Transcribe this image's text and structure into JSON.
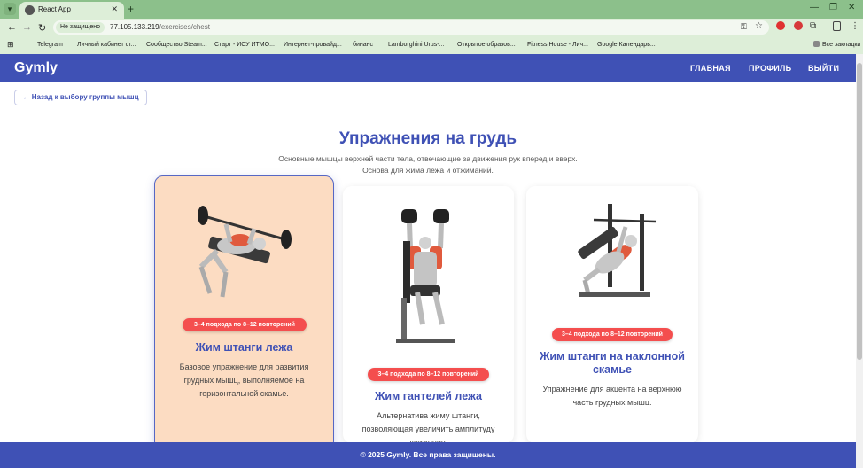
{
  "browser": {
    "tab_title": "React App",
    "new_tab": "+",
    "not_secure": "Не защищено",
    "url_host": "77.105.133.219",
    "url_path": "/exercises/chest",
    "bookmarks": [
      {
        "label": "Telegram",
        "color": "#2aa3df"
      },
      {
        "label": "Личный кабинет ст...",
        "color": "#3b5bdb"
      },
      {
        "label": "Сообщество Steam...",
        "color": "#1b2838"
      },
      {
        "label": "Старт - ИСУ ИТМО...",
        "color": "#444444"
      },
      {
        "label": "Интернет-провайд...",
        "color": "#e03131"
      },
      {
        "label": "бинанс",
        "color": "#f0b90b"
      },
      {
        "label": "Lamborghini Urus-...",
        "color": "#111111"
      },
      {
        "label": "Открытое образов...",
        "color": "#4c6ef5"
      },
      {
        "label": "Fitness House - Лич...",
        "color": "#3b3b98"
      },
      {
        "label": "Google Календарь...",
        "color": "#4285f4"
      }
    ],
    "all_bookmarks": "Все закладки"
  },
  "app": {
    "logo": "Gymly",
    "nav": [
      "ГЛАВНАЯ",
      "ПРОФИЛЬ",
      "ВЫЙТИ"
    ],
    "back_button": "← Назад к выбору группы мышц",
    "title": "Упражнения на грудь",
    "subtitle_line1": "Основные мышцы верхней части тела, отвечающие за движения рук вперед и вверх.",
    "subtitle_line2": "Основа для жима лежа и отжиманий.",
    "accent_color": "#3f51b5",
    "badge_color": "#f44e4e"
  },
  "exercises": [
    {
      "badge": "3–4 подхода по 8–12 повторений",
      "title": "Жим штанги лежа",
      "description": "Базовое упражнение для развития грудных мышц, выполняемое на горизонтальной скамье.",
      "icon": "barbell-bench-press-illustration"
    },
    {
      "badge": "3–4 подхода по 8–12 повторений",
      "title": "Жим гантелей лежа",
      "description": "Альтернатива жиму штанги, позволяющая увеличить амплитуду движения.",
      "icon": "dumbbell-press-illustration"
    },
    {
      "badge": "3–4 подхода по 8–12 повторений",
      "title_line1": "Жим штанги на наклонной",
      "title_line2": "скамье",
      "description": "Упражнение для акцента на верхнюю часть грудных мышц.",
      "icon": "incline-bench-press-illustration"
    }
  ],
  "footer": "© 2025 Gymly. Все права защищены."
}
